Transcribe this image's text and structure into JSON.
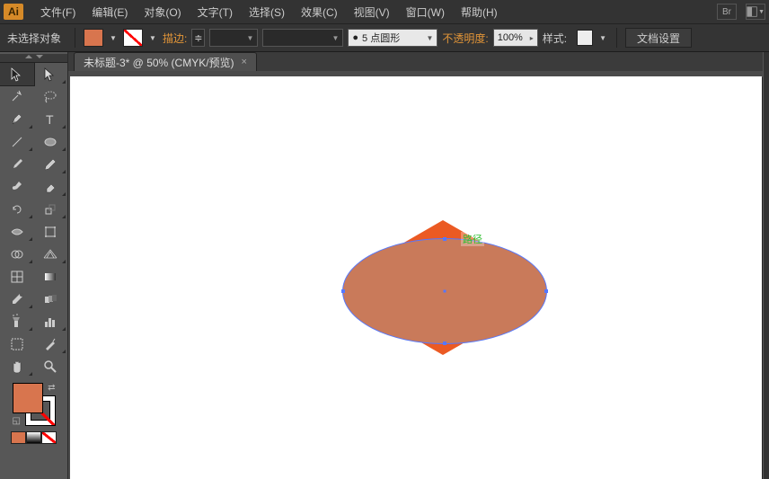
{
  "app": {
    "icon_text": "Ai"
  },
  "menu": {
    "items": [
      "文件(F)",
      "编辑(E)",
      "对象(O)",
      "文字(T)",
      "选择(S)",
      "效果(C)",
      "视图(V)",
      "窗口(W)",
      "帮助(H)"
    ],
    "extra_br": "Br"
  },
  "control": {
    "selection_state": "未选择对象",
    "stroke_label": "描边:",
    "stroke_weight": "",
    "brush_def": "5 点圆形",
    "brush_prefix": "●",
    "opacity_label": "不透明度:",
    "opacity_value": "100%",
    "style_label": "样式:",
    "doc_setup": "文档设置"
  },
  "tab": {
    "title": "未标题-3* @ 50% (CMYK/预览)",
    "close": "×"
  },
  "canvas": {
    "path_label": "路径"
  },
  "colors": {
    "fill": "#d8754e",
    "shape_hex": "#eb5a23",
    "shape_ellipse": "#c97a5a"
  }
}
